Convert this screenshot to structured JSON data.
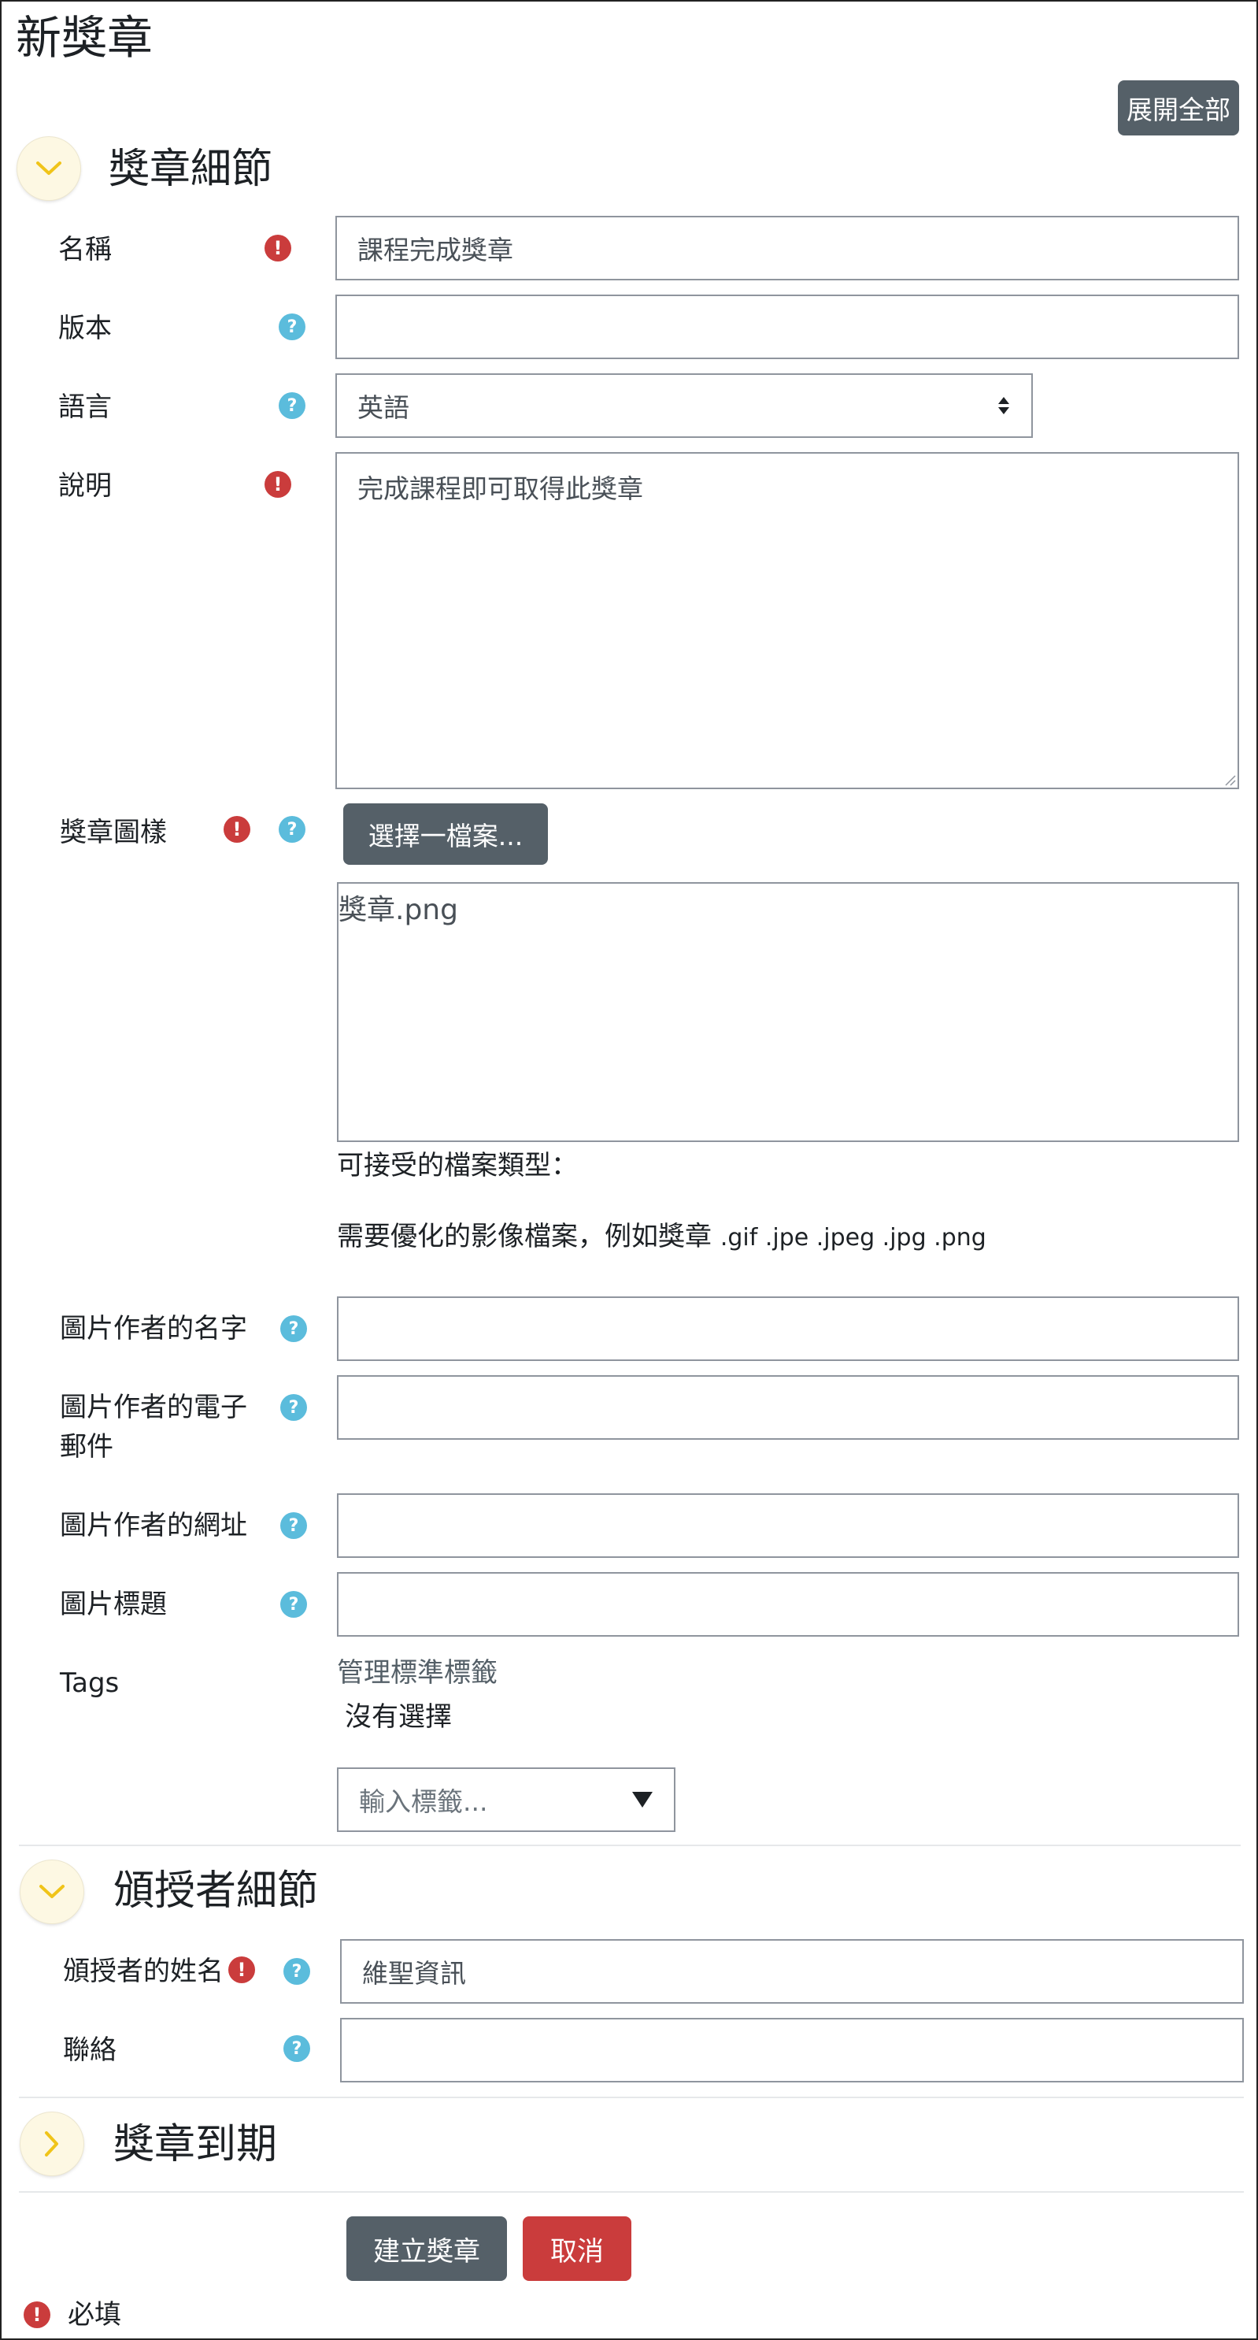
{
  "page": {
    "title": "新獎章",
    "expand_all_label": "展開全部"
  },
  "colors": {
    "primary_button": "#556068",
    "danger_button": "#ca3c3c",
    "required_icon": "#ca3c3c",
    "help_icon": "#5bbcdc",
    "section_toggle_bg": "#fdf8e3",
    "chevron": "#f0c419"
  },
  "sections": {
    "badge_details": {
      "title": "獎章細節",
      "expanded": true,
      "fields": {
        "name": {
          "label": "名稱",
          "value": "課程完成獎章",
          "required": true
        },
        "version": {
          "label": "版本",
          "value": "",
          "help": true
        },
        "language": {
          "label": "語言",
          "selected": "英語",
          "help": true
        },
        "description": {
          "label": "說明",
          "value": "完成課程即可取得此獎章",
          "required": true
        },
        "badge_image": {
          "label": "獎章圖樣",
          "choose_file_label": "選擇一檔案...",
          "file_name": "獎章.png",
          "accepted_types_label": "可接受的檔案類型：",
          "accepted_types_desc": "需要優化的影像檔案，例如獎章",
          "accepted_extensions": ".gif .jpe .jpeg .jpg .png"
        },
        "image_author_name": {
          "label": "圖片作者的名字",
          "value": ""
        },
        "image_author_email": {
          "label_line1": "圖片作者的電子",
          "label_line2": "郵件",
          "value": ""
        },
        "image_author_url": {
          "label": "圖片作者的網址",
          "value": ""
        },
        "image_caption": {
          "label": "圖片標題",
          "value": ""
        },
        "tags": {
          "label": "Tags",
          "manage_link": "管理標準標籤",
          "no_selection": "沒有選擇",
          "input_placeholder": "輸入標籤..."
        }
      }
    },
    "issuer_details": {
      "title": "頒授者細節",
      "expanded": true,
      "fields": {
        "issuer_name": {
          "label": "頒授者的姓名",
          "value": "維聖資訊",
          "required": true
        },
        "contact": {
          "label": "聯絡",
          "value": ""
        }
      }
    },
    "badge_expiry": {
      "title": "獎章到期",
      "expanded": false
    }
  },
  "actions": {
    "create_label": "建立獎章",
    "cancel_label": "取消"
  },
  "footer": {
    "required_legend": "必填"
  }
}
